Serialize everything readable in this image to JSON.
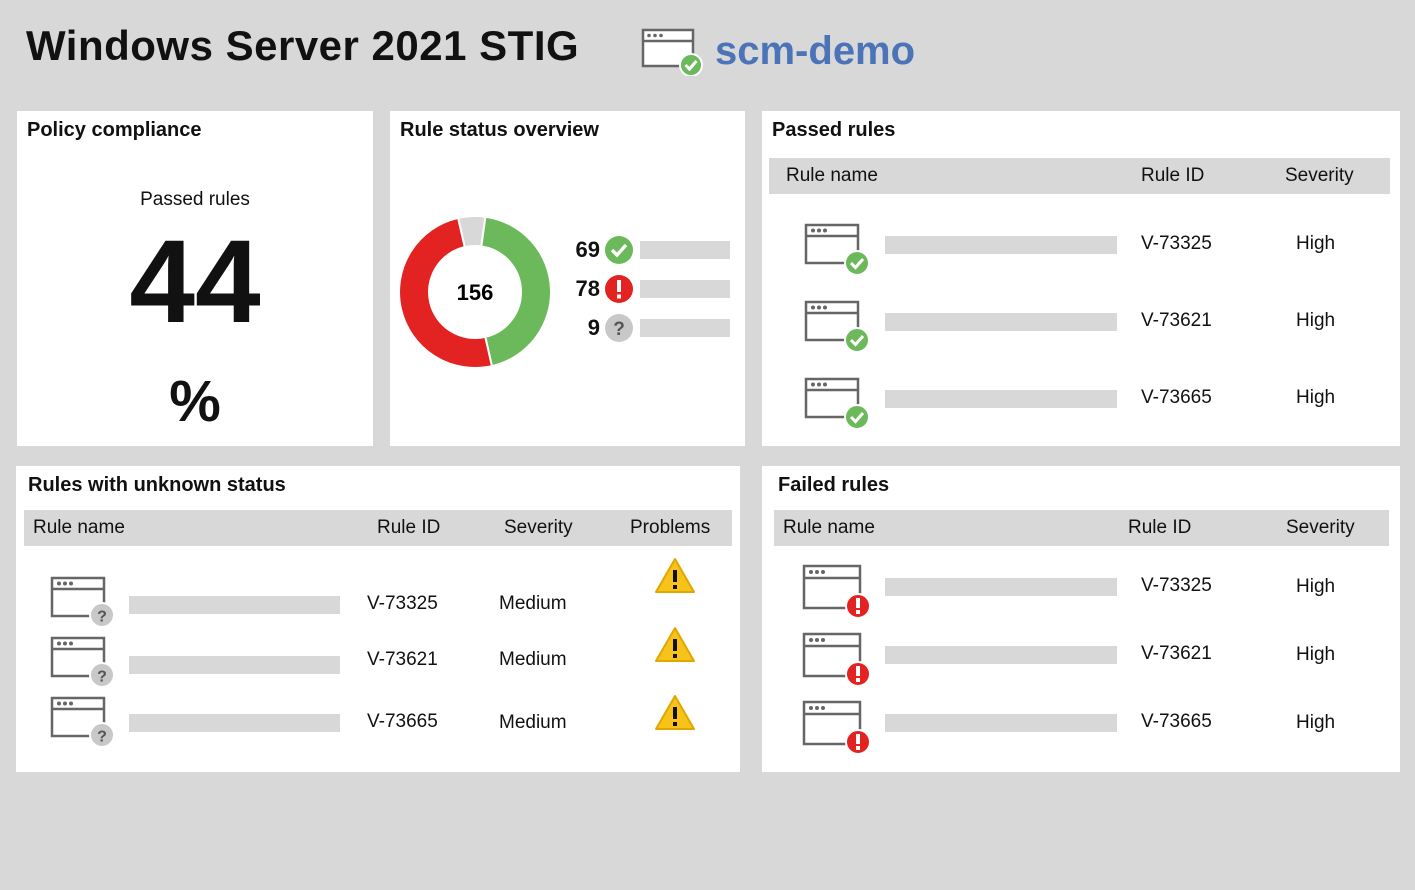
{
  "header": {
    "title": "Windows Server 2021 STIG",
    "host_icon": "server-window-check-icon",
    "host_name": "scm-demo"
  },
  "policy_compliance": {
    "title": "Policy compliance",
    "label": "Passed rules",
    "value": "44",
    "unit": "%"
  },
  "rule_status_overview": {
    "title": "Rule status overview",
    "total": "156",
    "stats": [
      {
        "value": "69",
        "icon": "check-circle-icon",
        "color": "#6cb95c"
      },
      {
        "value": "78",
        "icon": "exclamation-circle-icon",
        "color": "#e32222"
      },
      {
        "value": "9",
        "icon": "question-circle-icon",
        "color": "#c8c8c8"
      }
    ]
  },
  "chart_data": {
    "type": "pie",
    "center_label": "156",
    "segments": [
      {
        "value": 69,
        "color": "#6cb95c"
      },
      {
        "value": 78,
        "color": "#e32222"
      },
      {
        "value": 9,
        "color": "#d8d8d8"
      }
    ]
  },
  "passed_rules": {
    "title": "Passed rules",
    "columns": [
      "Rule name",
      "Rule ID",
      "Severity"
    ],
    "rows": [
      {
        "rule_id": "V-73325",
        "severity": "High"
      },
      {
        "rule_id": "V-73621",
        "severity": "High"
      },
      {
        "rule_id": "V-73665",
        "severity": "High"
      }
    ]
  },
  "unknown_rules": {
    "title": "Rules with unknown status",
    "columns": [
      "Rule name",
      "Rule ID",
      "Severity",
      "Problems"
    ],
    "rows": [
      {
        "rule_id": "V-73325",
        "severity": "Medium",
        "problem_icon": "warning-triangle-icon"
      },
      {
        "rule_id": "V-73621",
        "severity": "Medium",
        "problem_icon": "warning-triangle-icon"
      },
      {
        "rule_id": "V-73665",
        "severity": "Medium",
        "problem_icon": "warning-triangle-icon"
      }
    ]
  },
  "failed_rules": {
    "title": "Failed rules",
    "columns": [
      "Rule name",
      "Rule ID",
      "Severity"
    ],
    "rows": [
      {
        "rule_id": "V-73325",
        "severity": "High"
      },
      {
        "rule_id": "V-73621",
        "severity": "High"
      },
      {
        "rule_id": "V-73665",
        "severity": "High"
      }
    ]
  },
  "colors": {
    "pass": "#6cb95c",
    "fail": "#e32222",
    "unknown": "#c8c8c8",
    "warning": "#f7c21a",
    "brand": "#4a73b8"
  }
}
